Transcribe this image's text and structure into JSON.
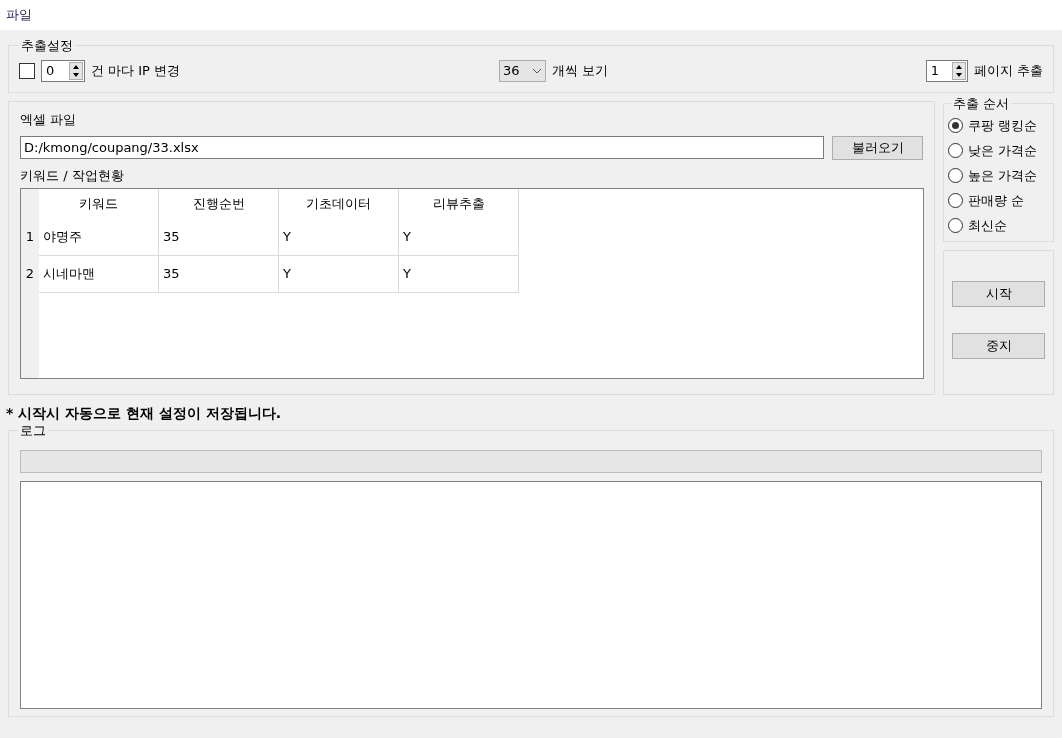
{
  "menu": [
    "파일"
  ],
  "extract_settings": {
    "title": "추출설정",
    "ip_change": {
      "checked": false,
      "value": "0",
      "label": "건 마다 IP 변경"
    },
    "per_page": {
      "value": "36",
      "label": "개씩 보기"
    },
    "pages": {
      "value": "1",
      "label": "페이지 추출"
    }
  },
  "excel": {
    "label": "엑셀 파일",
    "path": "D:/kmong/coupang/33.xlsx",
    "load_button": "불러오기",
    "table_label": "키워드 / 작업현황",
    "table": {
      "columns": [
        "키워드",
        "진행순번",
        "기초데이터",
        "리뷰추출"
      ],
      "rows": [
        {
          "index": "1",
          "cells": [
            "야명주",
            "35",
            "Y",
            "Y"
          ]
        },
        {
          "index": "2",
          "cells": [
            "시네마맨",
            "35",
            "Y",
            "Y"
          ]
        }
      ]
    }
  },
  "order": {
    "title": "추출 순서",
    "options": [
      {
        "label": "쿠팡 랭킹순",
        "selected": true
      },
      {
        "label": "낮은 가격순",
        "selected": false
      },
      {
        "label": "높은 가격순",
        "selected": false
      },
      {
        "label": "판매량 순",
        "selected": false
      },
      {
        "label": "최신순",
        "selected": false
      }
    ]
  },
  "actions": [
    "시작",
    "중지"
  ],
  "note": "* 시작시 자동으로 현재 설정이 저장됩니다.",
  "log": {
    "title": "로그",
    "progress": {
      "level": 0
    }
  }
}
